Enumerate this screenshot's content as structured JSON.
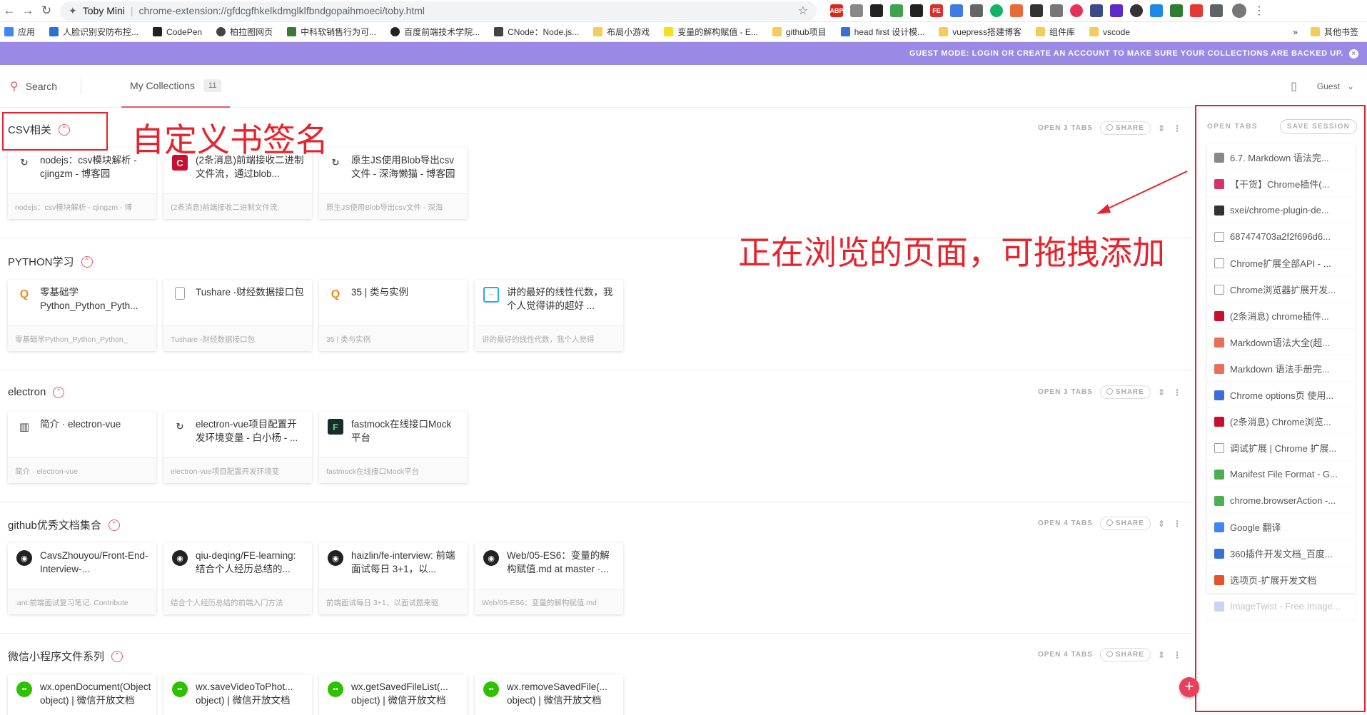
{
  "browser": {
    "tab_title": "Toby Mini",
    "url": "chrome-extension://gfdcgfhkelkdmglklfbndgopaihmoeci/toby.html"
  },
  "bookmarks": [
    {
      "label": "应用",
      "icon": "apps-grid-icon",
      "color": "#4285f4"
    },
    {
      "label": "人脸识别安防布控...",
      "icon": "bookmark-favicon",
      "color": "#2d6fd6"
    },
    {
      "label": "CodePen",
      "icon": "codepen-icon",
      "color": "#222222"
    },
    {
      "label": "柏拉图网页",
      "icon": "globe-icon",
      "color": "#444444"
    },
    {
      "label": "中科软销售行为可...",
      "icon": "bookmark-favicon",
      "color": "#3b7a3b"
    },
    {
      "label": "百度前端技术学院...",
      "icon": "bookmark-favicon",
      "color": "#222222"
    },
    {
      "label": "CNode：Node.js...",
      "icon": "cnode-icon",
      "color": "#444444"
    },
    {
      "label": "布局小游戏",
      "icon": "folder-icon",
      "color": "#f5cc5a"
    },
    {
      "label": "变量的解构赋值 - E...",
      "icon": "es-icon",
      "color": "#f7df1e"
    },
    {
      "label": "github项目",
      "icon": "folder-icon",
      "color": "#f5cc5a"
    },
    {
      "label": "head first 设计模...",
      "icon": "baidu-paw-icon",
      "color": "#3a6fd8"
    },
    {
      "label": "vuepress搭建博客",
      "icon": "folder-icon",
      "color": "#f5cc5a"
    },
    {
      "label": "组件库",
      "icon": "folder-icon",
      "color": "#f5cc5a"
    },
    {
      "label": "vscode",
      "icon": "folder-icon",
      "color": "#f5cc5a"
    }
  ],
  "bookmarks_overflow": "»",
  "bookmarks_other": "其他书签",
  "guest_banner": "GUEST MODE: LOGIN OR CREATE AN ACCOUNT TO MAKE SURE YOUR COLLECTIONS ARE BACKED UP.",
  "header": {
    "search_label": "Search",
    "my_collections_label": "My Collections",
    "collection_count": "11",
    "user_label": "Guest"
  },
  "collections": [
    {
      "title": "CSV相关",
      "open_label": "OPEN 3 TABS",
      "share_label": "SHARE",
      "cards": [
        {
          "title": "nodejs：csv模块解析 - cjingzm - 博客园",
          "desc": "nodejs：csv模块解析 - cjingzm - 博",
          "icon": "cnblogs-icon"
        },
        {
          "title": "(2条消息)前端接收二进制文件流，通过blob...",
          "desc": "(2条消息)前端接收二进制文件流,",
          "icon": "csdn-icon"
        },
        {
          "title": "原生JS使用Blob导出csv文件 - 深海懒猫 - 博客园",
          "desc": "原生JS使用Blob导出csv文件 - 深海",
          "icon": "cnblogs-icon"
        }
      ]
    },
    {
      "title": "PYTHON学习",
      "open_label": "",
      "share_label": "",
      "cards": [
        {
          "title": "零基础学Python_Python_Pyth...",
          "desc": "零基础学Python_Python_Python_",
          "icon": "orange-q-icon"
        },
        {
          "title": "Tushare -财经数据接口包",
          "desc": "Tushare -财经数据接口包",
          "icon": "blank-page-icon"
        },
        {
          "title": "35 | 类与实例",
          "desc": "35 | 类与实例",
          "icon": "orange-q-icon"
        },
        {
          "title": "讲的最好的线性代数，我个人觉得讲的超好 ...",
          "desc": "讲的最好的线性代数，我个人觉得",
          "icon": "bilibili-icon"
        }
      ]
    },
    {
      "title": "electron",
      "open_label": "OPEN 3 TABS",
      "share_label": "SHARE",
      "cards": [
        {
          "title": "简介 · electron-vue",
          "desc": "简介 · electron-vue",
          "icon": "book-icon"
        },
        {
          "title": "electron-vue项目配置开发环境变量 - 白小杨 - ...",
          "desc": "electron-vue项目配置开发环境变",
          "icon": "cnblogs-icon"
        },
        {
          "title": "fastmock在线接口Mock平台",
          "desc": "fastmock在线接口Mock平台",
          "icon": "fastmock-icon"
        }
      ]
    },
    {
      "title": "github优秀文档集合",
      "open_label": "OPEN 4 TABS",
      "share_label": "SHARE",
      "cards": [
        {
          "title": "CavsZhouyou/Front-End-Interview-...",
          "desc": ":ant:前端面试复习笔记. Contribute",
          "icon": "github-icon"
        },
        {
          "title": "qiu-deqing/FE-learning: 结合个人经历总结的...",
          "desc": "结合个人经历总结的前端入门方法",
          "icon": "github-icon"
        },
        {
          "title": "haizlin/fe-interview: 前端面试每日 3+1，以...",
          "desc": "前端面试每日 3+1，以面试题来驱",
          "icon": "github-icon"
        },
        {
          "title": "Web/05-ES6：变量的解构赋值.md at master ·...",
          "desc": "Web/05-ES6：变量的解构赋值.md",
          "icon": "github-icon"
        }
      ]
    },
    {
      "title": "微信小程序文件系列",
      "open_label": "OPEN 4 TABS",
      "share_label": "SHARE",
      "cards": [
        {
          "title": "wx.openDocument(Object object) | 微信开放文档",
          "desc": "",
          "icon": "wechat-icon"
        },
        {
          "title": "wx.saveVideoToPhot... object) | 微信开放文档",
          "desc": "",
          "icon": "wechat-icon"
        },
        {
          "title": "wx.getSavedFileList(... object) | 微信开放文档",
          "desc": "",
          "icon": "wechat-icon"
        },
        {
          "title": "wx.removeSavedFile(... object) | 微信开放文档",
          "desc": "",
          "icon": "wechat-icon"
        }
      ]
    }
  ],
  "annotations": {
    "bookmark_name_note": "自定义书签名",
    "browsing_note": "正在浏览的页面，可拖拽添加"
  },
  "sidebar": {
    "open_tabs_label": "OPEN TABS",
    "save_session_label": "SAVE SESSION",
    "tabs": [
      {
        "label": "6.7. Markdown 语法完...",
        "icon": "md-icon",
        "color": "#888888"
      },
      {
        "label": "【干货】Chrome插件(...",
        "icon": "chrome-ext-icon",
        "color": "#d6336c"
      },
      {
        "label": "sxei/chrome-plugin-de...",
        "icon": "github-icon",
        "color": "#333333"
      },
      {
        "label": "687474703a2f2f696d6...",
        "icon": "blank-page-icon",
        "color": "#ffffff"
      },
      {
        "label": "Chrome扩展全部API - ...",
        "icon": "cnblogs-icon",
        "color": "#ffffff"
      },
      {
        "label": "Chrome浏览器扩展开发...",
        "icon": "cnblogs-icon",
        "color": "#ffffff"
      },
      {
        "label": "(2条消息) chrome插件...",
        "icon": "csdn-icon",
        "color": "#c8102e"
      },
      {
        "label": "Markdown语法大全(超...",
        "icon": "jianshu-icon",
        "color": "#ea6f5a"
      },
      {
        "label": "Markdown 语法手册完...",
        "icon": "jianshu-icon",
        "color": "#ea6f5a"
      },
      {
        "label": "Chrome options页 使用...",
        "icon": "baidu-paw-icon",
        "color": "#3a6fd8"
      },
      {
        "label": "(2条消息) Chrome浏览...",
        "icon": "csdn-icon",
        "color": "#c8102e"
      },
      {
        "label": "调试扩展 | Chrome 扩展...",
        "icon": "blank-page-icon",
        "color": "#ffffff"
      },
      {
        "label": "Manifest File Format - G...",
        "icon": "chrome-icon",
        "color": "#4caf50"
      },
      {
        "label": "chrome.browserAction -...",
        "icon": "chrome-icon",
        "color": "#4caf50"
      },
      {
        "label": "Google 翻译",
        "icon": "google-translate-icon",
        "color": "#4285f4"
      },
      {
        "label": "360插件开发文档_百度...",
        "icon": "baidu-paw-icon",
        "color": "#3a6fd8"
      },
      {
        "label": "选项页-扩展开发文档",
        "icon": "360-icon",
        "color": "#e6522c"
      },
      {
        "label": "ImageTwist - Free Image...",
        "icon": "imagetwist-icon",
        "color": "#6a8ad8"
      }
    ]
  },
  "colors": {
    "accent": "#e55a6e",
    "banner": "#9b89e6",
    "annotation_red": "#e8222b"
  }
}
